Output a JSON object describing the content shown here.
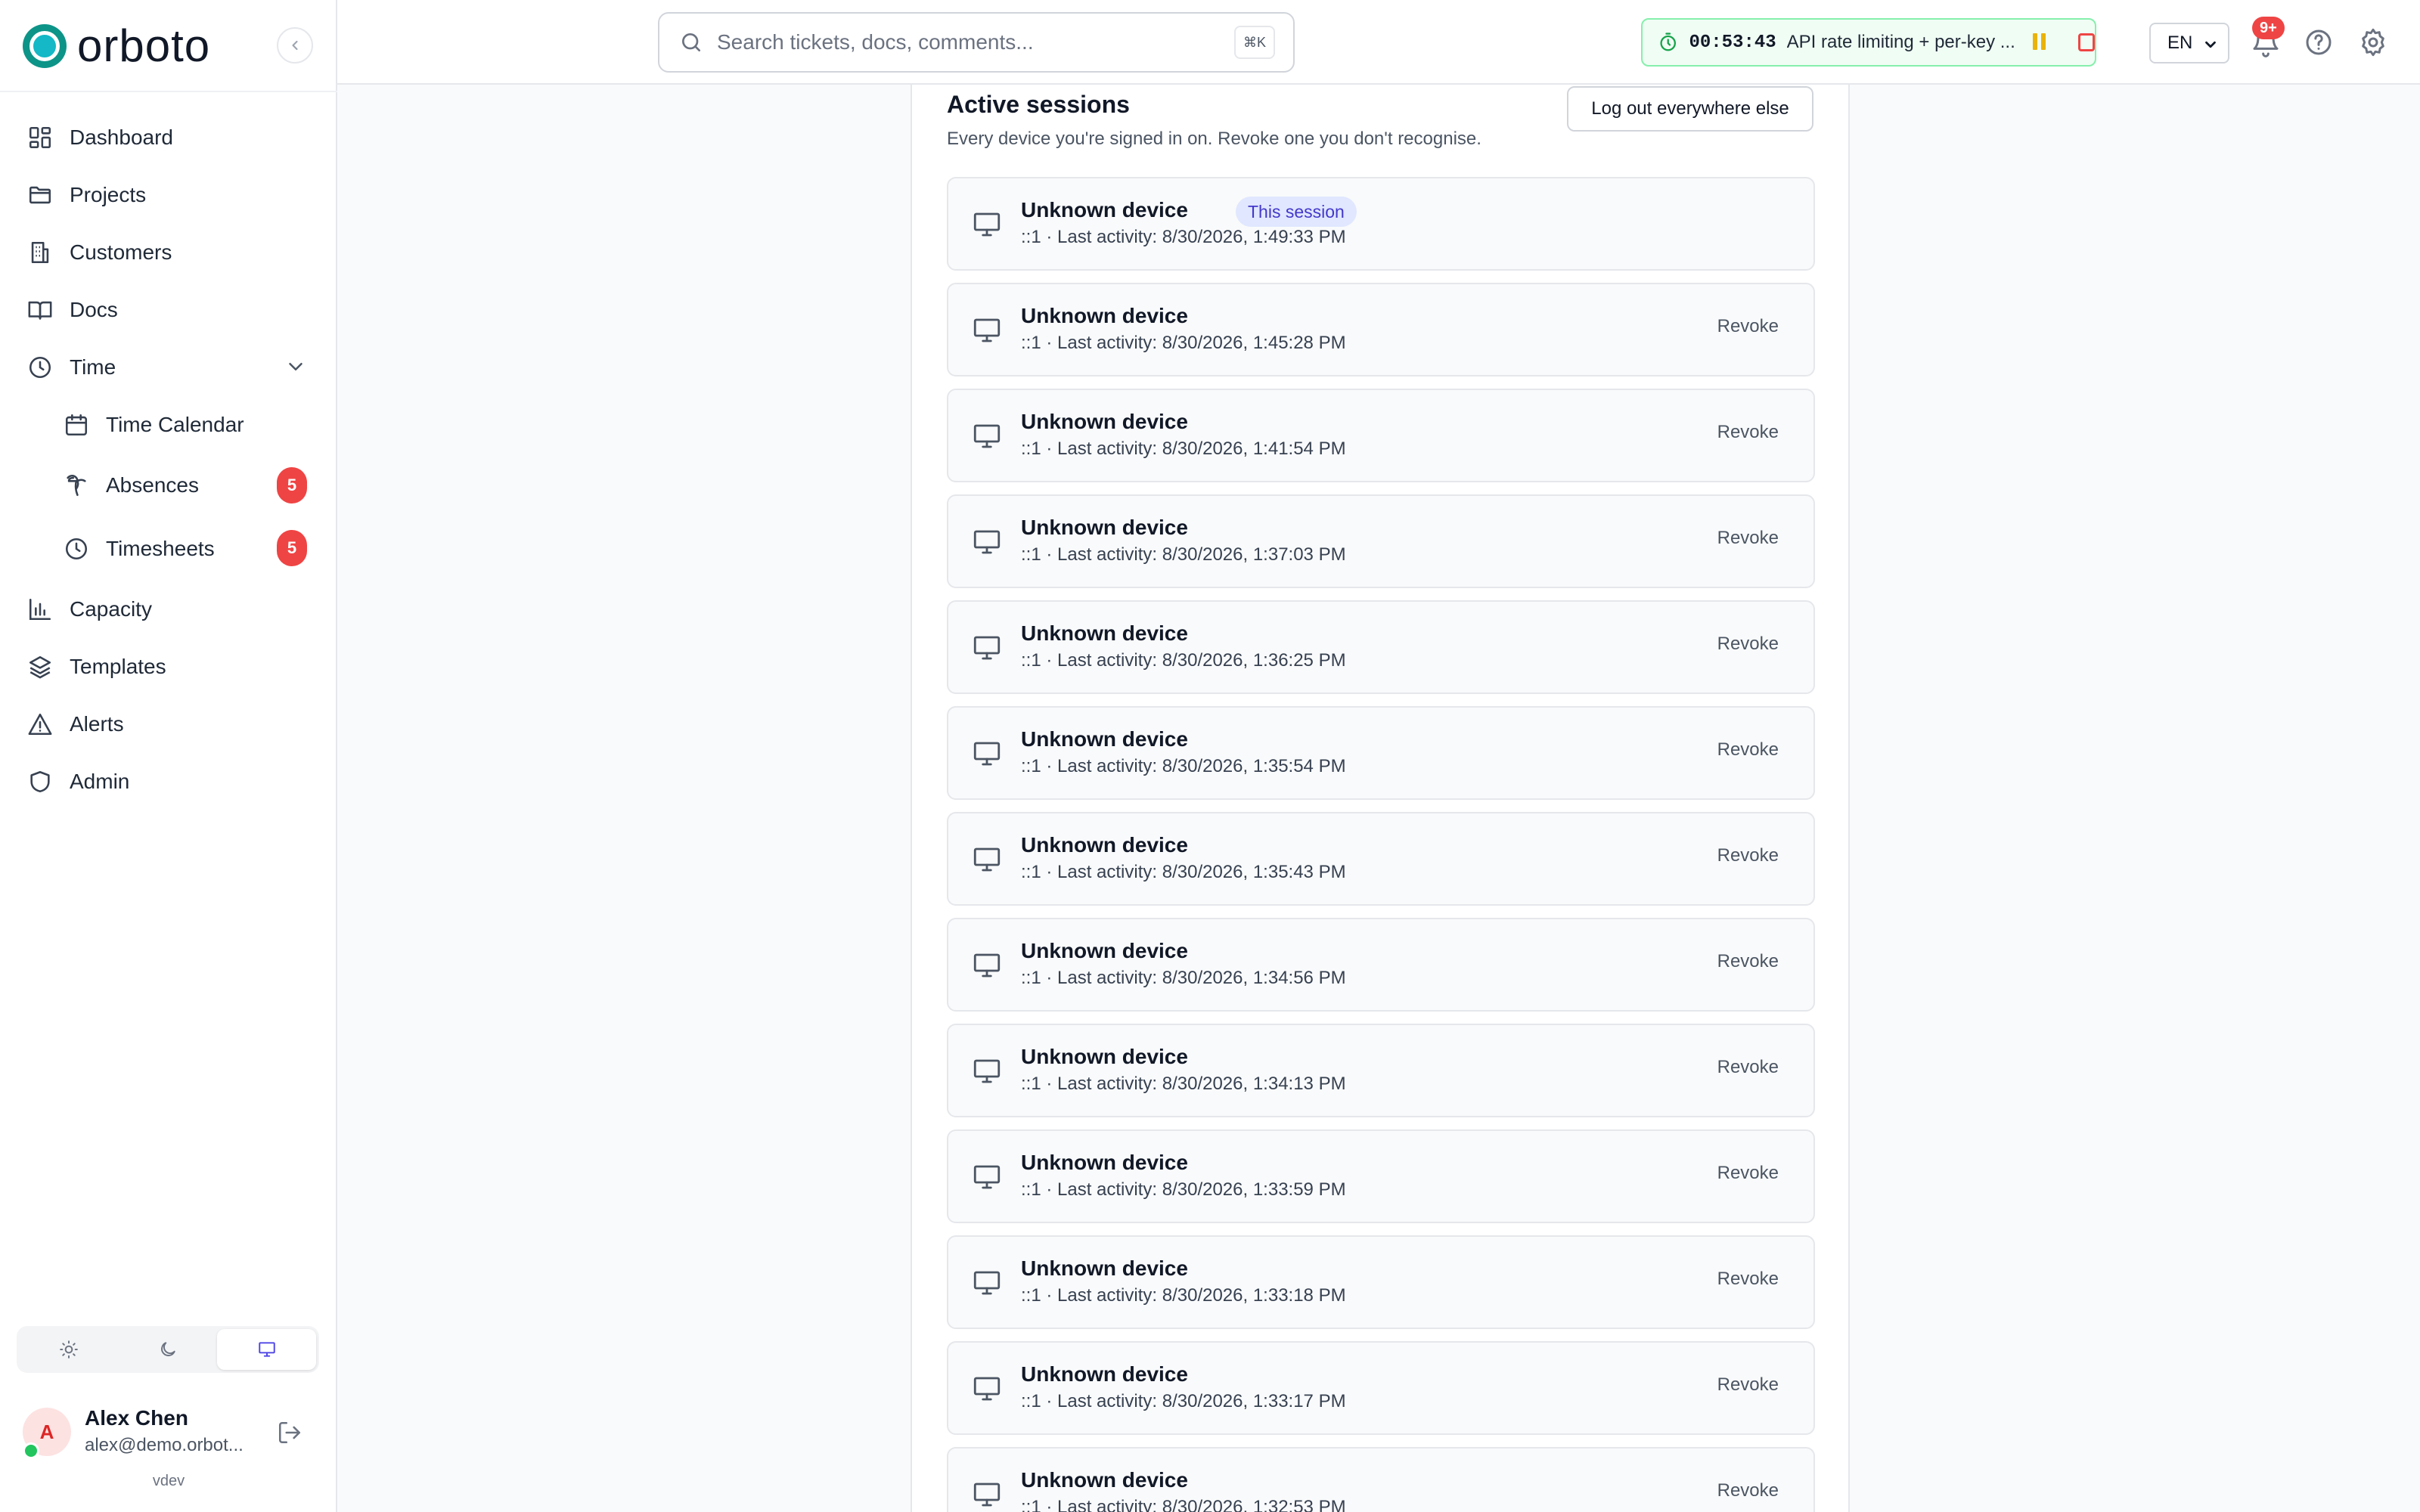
{
  "app": {
    "name": "orboto",
    "version": "vdev"
  },
  "sidebar": {
    "items": [
      {
        "label": "Dashboard",
        "icon": "grid-icon"
      },
      {
        "label": "Projects",
        "icon": "folder-icon"
      },
      {
        "label": "Customers",
        "icon": "building-icon"
      },
      {
        "label": "Docs",
        "icon": "book-icon"
      },
      {
        "label": "Time",
        "icon": "clock-icon"
      },
      {
        "label": "Time Calendar",
        "icon": "calendar-icon"
      },
      {
        "label": "Absences",
        "icon": "palm-tree-icon",
        "badge": "5"
      },
      {
        "label": "Timesheets",
        "icon": "clock-icon",
        "badge": "5"
      },
      {
        "label": "Capacity",
        "icon": "bar-chart-icon"
      },
      {
        "label": "Templates",
        "icon": "layers-icon"
      },
      {
        "label": "Alerts",
        "icon": "alert-triangle-icon"
      },
      {
        "label": "Admin",
        "icon": "shield-icon"
      }
    ],
    "theme_modes": [
      "light",
      "dark",
      "system"
    ],
    "theme_active": "system",
    "user": {
      "initial": "A",
      "name": "Alex Chen",
      "email": "alex@demo.orbot..."
    }
  },
  "header": {
    "search_placeholder": "Search tickets, docs, comments...",
    "search_shortcut": "⌘K",
    "timer": {
      "time": "00:53:43",
      "task": "API rate limiting + per-key ..."
    },
    "language": "EN",
    "notifications_badge": "9+"
  },
  "main": {
    "title": "Active sessions",
    "subtitle": "Every device you're signed in on. Revoke one you don't recognise.",
    "logout_all_label": "Log out everywhere else",
    "current_session_label": "This session",
    "revoke_label": "Revoke",
    "sessions": [
      {
        "device": "Unknown device",
        "meta": "::1 · Last activity: 8/30/2026, 1:49:33 PM",
        "current": true
      },
      {
        "device": "Unknown device",
        "meta": "::1 · Last activity: 8/30/2026, 1:45:28 PM"
      },
      {
        "device": "Unknown device",
        "meta": "::1 · Last activity: 8/30/2026, 1:41:54 PM"
      },
      {
        "device": "Unknown device",
        "meta": "::1 · Last activity: 8/30/2026, 1:37:03 PM"
      },
      {
        "device": "Unknown device",
        "meta": "::1 · Last activity: 8/30/2026, 1:36:25 PM"
      },
      {
        "device": "Unknown device",
        "meta": "::1 · Last activity: 8/30/2026, 1:35:54 PM"
      },
      {
        "device": "Unknown device",
        "meta": "::1 · Last activity: 8/30/2026, 1:35:43 PM"
      },
      {
        "device": "Unknown device",
        "meta": "::1 · Last activity: 8/30/2026, 1:34:56 PM"
      },
      {
        "device": "Unknown device",
        "meta": "::1 · Last activity: 8/30/2026, 1:34:13 PM"
      },
      {
        "device": "Unknown device",
        "meta": "::1 · Last activity: 8/30/2026, 1:33:59 PM"
      },
      {
        "device": "Unknown device",
        "meta": "::1 · Last activity: 8/30/2026, 1:33:18 PM"
      },
      {
        "device": "Unknown device",
        "meta": "::1 · Last activity: 8/30/2026, 1:33:17 PM"
      },
      {
        "device": "Unknown device",
        "meta": "::1 · Last activity: 8/30/2026, 1:32:53 PM"
      }
    ]
  },
  "colors": {
    "brand": "#14b8c6",
    "badge": "#ef4444",
    "timer_border": "#86efac",
    "pill_bg": "#e0e7ff",
    "pill_text": "#4338ca"
  }
}
